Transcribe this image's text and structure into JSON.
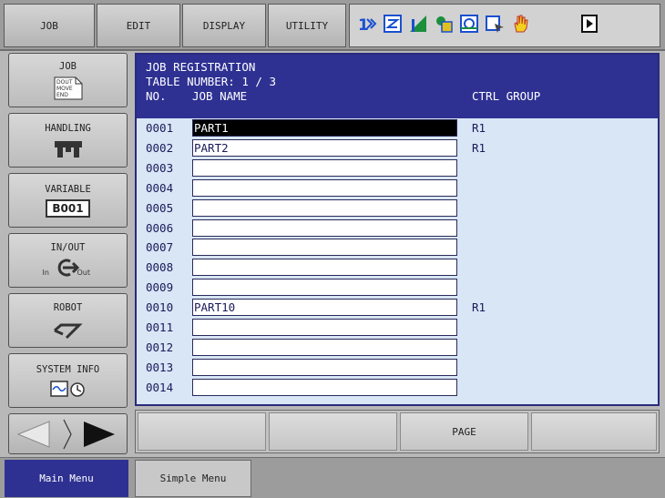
{
  "top_menu": {
    "job": "JOB",
    "edit": "EDIT",
    "display": "DISPLAY",
    "utility": "UTILITY"
  },
  "status_icons": [
    "step-mode-icon",
    "edit-mode-icon",
    "cycle-icon",
    "security-icon",
    "playback-icon",
    "cursor-icon",
    "hand-icon",
    "play-icon"
  ],
  "side_menu": {
    "job": "JOB",
    "job_icon_lines": [
      "DOUT",
      "MOVE",
      "END"
    ],
    "handling": "HANDLING",
    "variable": "VARIABLE",
    "variable_badge": "B001",
    "inout": "IN/OUT",
    "inout_in": "In",
    "inout_out": "Out",
    "robot": "ROBOT",
    "system_info": "SYSTEM INFO"
  },
  "panel": {
    "title": "JOB REGISTRATION",
    "table_number": "TABLE NUMBER: 1 / 3",
    "col_no": "NO.",
    "col_job_name": "JOB NAME",
    "col_ctrl_group": "CTRL GROUP",
    "rows": [
      {
        "no": "0001",
        "name": "PART1",
        "group": "R1",
        "selected": true
      },
      {
        "no": "0002",
        "name": "PART2",
        "group": "R1",
        "selected": false
      },
      {
        "no": "0003",
        "name": "",
        "group": "",
        "selected": false
      },
      {
        "no": "0004",
        "name": "",
        "group": "",
        "selected": false
      },
      {
        "no": "0005",
        "name": "",
        "group": "",
        "selected": false
      },
      {
        "no": "0006",
        "name": "",
        "group": "",
        "selected": false
      },
      {
        "no": "0007",
        "name": "",
        "group": "",
        "selected": false
      },
      {
        "no": "0008",
        "name": "",
        "group": "",
        "selected": false
      },
      {
        "no": "0009",
        "name": "",
        "group": "",
        "selected": false
      },
      {
        "no": "0010",
        "name": "PART10",
        "group": "R1",
        "selected": false
      },
      {
        "no": "0011",
        "name": "",
        "group": "",
        "selected": false
      },
      {
        "no": "0012",
        "name": "",
        "group": "",
        "selected": false
      },
      {
        "no": "0013",
        "name": "",
        "group": "",
        "selected": false
      },
      {
        "no": "0014",
        "name": "",
        "group": "",
        "selected": false
      }
    ]
  },
  "function_bar": {
    "keys": [
      "",
      "",
      "",
      "PAGE",
      ""
    ]
  },
  "tabs": {
    "main_menu": "Main Menu",
    "simple_menu": "Simple Menu"
  },
  "colors": {
    "header_blue": "#2e3192",
    "panel_bg": "#d8e6f5",
    "selected_bg": "#000000"
  }
}
